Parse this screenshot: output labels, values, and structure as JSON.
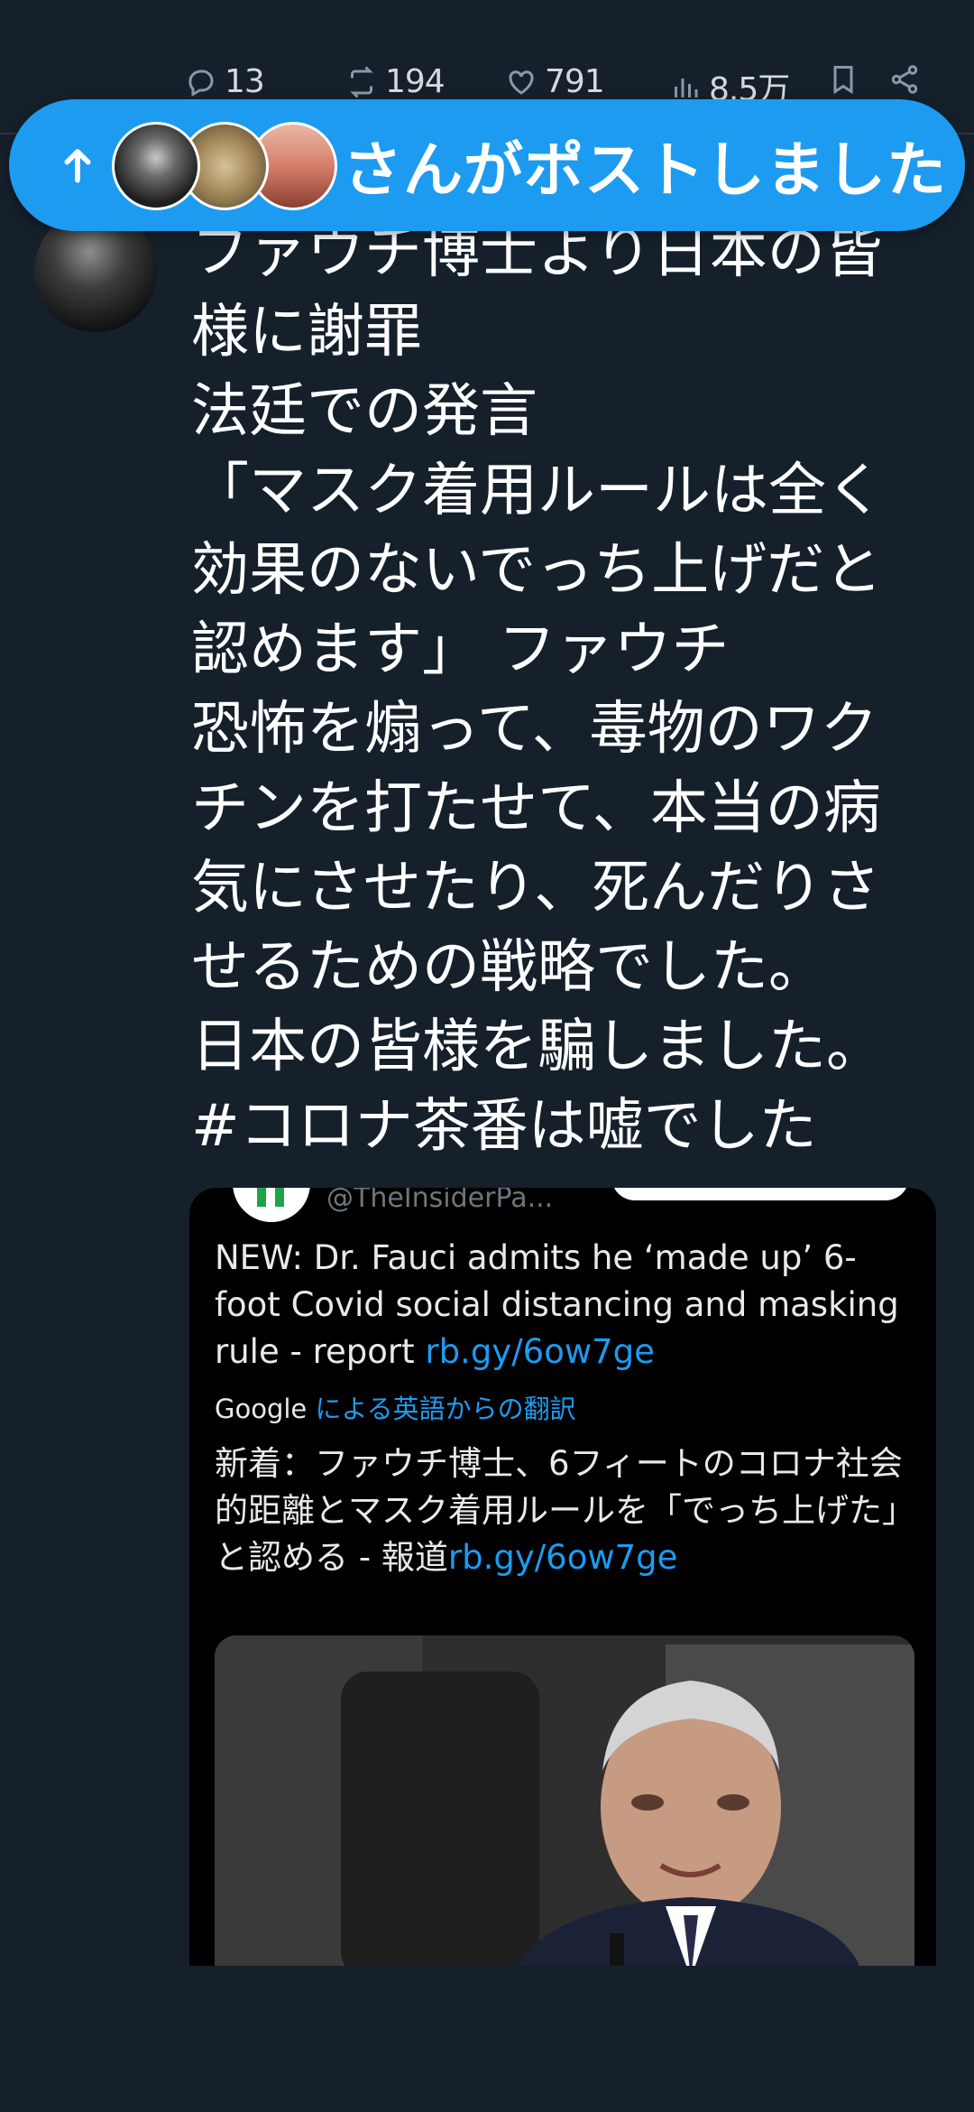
{
  "action_bar": {
    "replies": "13",
    "reposts": "194",
    "likes": "791",
    "views": "8.5万"
  },
  "repost_pill": {
    "text": "さんがポストしました"
  },
  "tweet": {
    "lines": [
      "ファウチ博士より日本の皆",
      "様に謝罪",
      "法廷での発言",
      "「マスク着用ルールは全く",
      "効果のないでっち上げだと",
      "認めます」 ファウチ",
      "恐怖を煽って、毒物のワク",
      "チンを打たせて、本当の病",
      "気にさせたり、死んだりさ",
      "せるための戦略でした。",
      "日本の皆様を騙しました。",
      "#コロナ茶番は嘘でした"
    ]
  },
  "card": {
    "handle": "@TheInsiderPa...",
    "en_text": "NEW: Dr. Fauci admits he ‘made up’ 6-foot Covid social distancing and masking rule - report ",
    "en_link": "rb.gy/6ow7ge",
    "translate_brand": "Google",
    "translate_text": "による英語からの翻訳",
    "jp_text": "新着：ファウチ博士、6フィートのコロナ社会的距離とマスク着用ルールを「でっち上げた」と認める - 報道",
    "jp_link": "rb.gy/6ow7ge"
  },
  "colors": {
    "background": "#15202b",
    "accent": "#1d9bf0",
    "muted": "#8b98a5"
  },
  "icons": [
    "reply-icon",
    "repost-icon",
    "like-icon",
    "views-icon",
    "bookmark-icon",
    "share-icon",
    "arrow-up-icon"
  ]
}
